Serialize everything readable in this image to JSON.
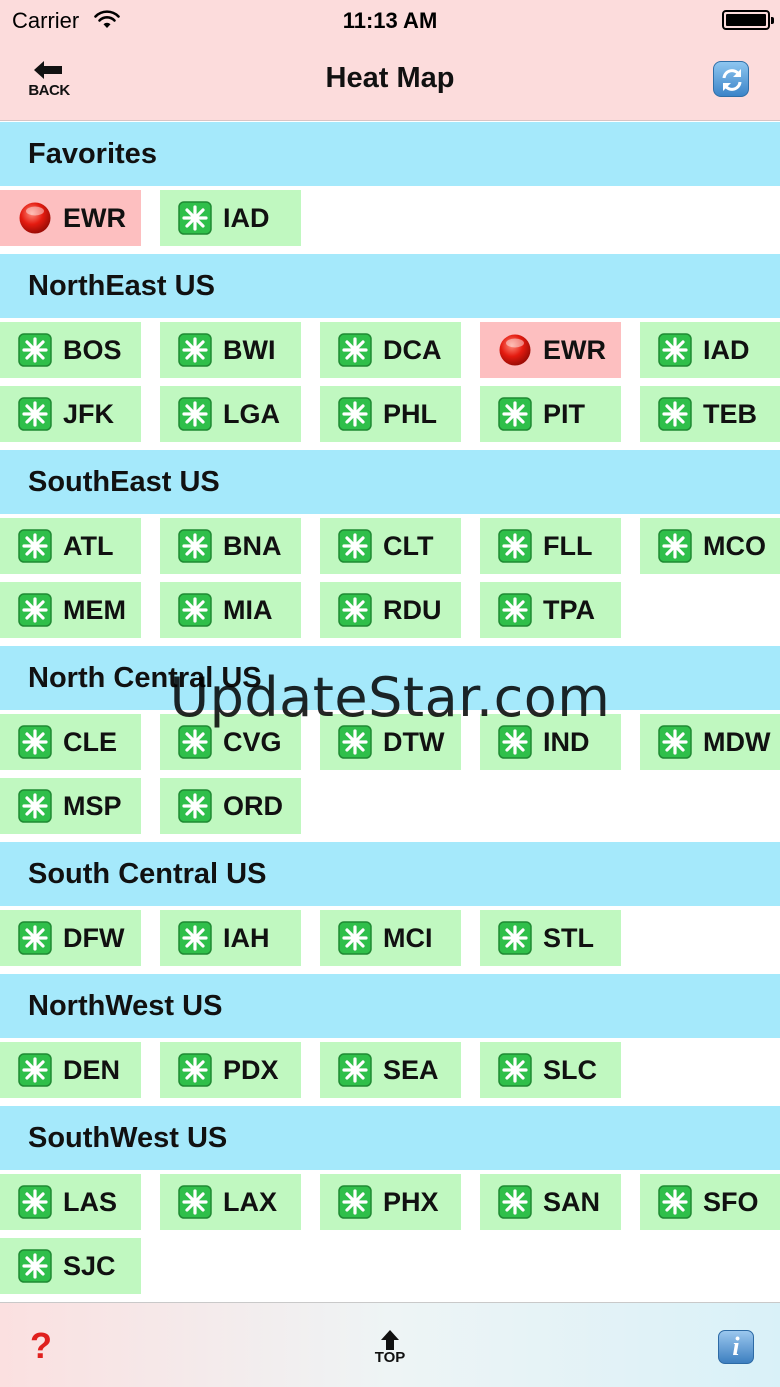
{
  "status_bar": {
    "carrier": "Carrier",
    "time": "11:13 AM"
  },
  "nav": {
    "back_label": "BACK",
    "title": "Heat Map"
  },
  "sections": [
    {
      "title": "Favorites",
      "airports": [
        {
          "code": "EWR",
          "status": "red"
        },
        {
          "code": "IAD",
          "status": "green"
        }
      ]
    },
    {
      "title": "NorthEast US",
      "airports": [
        {
          "code": "BOS",
          "status": "green"
        },
        {
          "code": "BWI",
          "status": "green"
        },
        {
          "code": "DCA",
          "status": "green"
        },
        {
          "code": "EWR",
          "status": "red"
        },
        {
          "code": "IAD",
          "status": "green"
        },
        {
          "code": "JFK",
          "status": "green"
        },
        {
          "code": "LGA",
          "status": "green"
        },
        {
          "code": "PHL",
          "status": "green"
        },
        {
          "code": "PIT",
          "status": "green"
        },
        {
          "code": "TEB",
          "status": "green"
        }
      ]
    },
    {
      "title": "SouthEast US",
      "airports": [
        {
          "code": "ATL",
          "status": "green"
        },
        {
          "code": "BNA",
          "status": "green"
        },
        {
          "code": "CLT",
          "status": "green"
        },
        {
          "code": "FLL",
          "status": "green"
        },
        {
          "code": "MCO",
          "status": "green"
        },
        {
          "code": "MEM",
          "status": "green"
        },
        {
          "code": "MIA",
          "status": "green"
        },
        {
          "code": "RDU",
          "status": "green"
        },
        {
          "code": "TPA",
          "status": "green"
        }
      ]
    },
    {
      "title": "North Central US",
      "airports": [
        {
          "code": "CLE",
          "status": "green"
        },
        {
          "code": "CVG",
          "status": "green"
        },
        {
          "code": "DTW",
          "status": "green"
        },
        {
          "code": "IND",
          "status": "green"
        },
        {
          "code": "MDW",
          "status": "green"
        },
        {
          "code": "MSP",
          "status": "green"
        },
        {
          "code": "ORD",
          "status": "green"
        }
      ]
    },
    {
      "title": "South Central US",
      "airports": [
        {
          "code": "DFW",
          "status": "green"
        },
        {
          "code": "IAH",
          "status": "green"
        },
        {
          "code": "MCI",
          "status": "green"
        },
        {
          "code": "STL",
          "status": "green"
        }
      ]
    },
    {
      "title": "NorthWest US",
      "airports": [
        {
          "code": "DEN",
          "status": "green"
        },
        {
          "code": "PDX",
          "status": "green"
        },
        {
          "code": "SEA",
          "status": "green"
        },
        {
          "code": "SLC",
          "status": "green"
        }
      ]
    },
    {
      "title": "SouthWest US",
      "airports": [
        {
          "code": "LAS",
          "status": "green"
        },
        {
          "code": "LAX",
          "status": "green"
        },
        {
          "code": "PHX",
          "status": "green"
        },
        {
          "code": "SAN",
          "status": "green"
        },
        {
          "code": "SFO",
          "status": "green"
        },
        {
          "code": "SJC",
          "status": "green"
        }
      ]
    }
  ],
  "status_colors": {
    "green": "#c0f8c0",
    "red": "#fdbfc0",
    "section": "#a5e9fb"
  },
  "status_icons": {
    "green": "green-sparkle-icon",
    "red": "red-circle-icon"
  },
  "toolbar": {
    "help_label": "?",
    "top_label": "TOP",
    "info_label": "i"
  },
  "watermark": "UpdateStar.com"
}
